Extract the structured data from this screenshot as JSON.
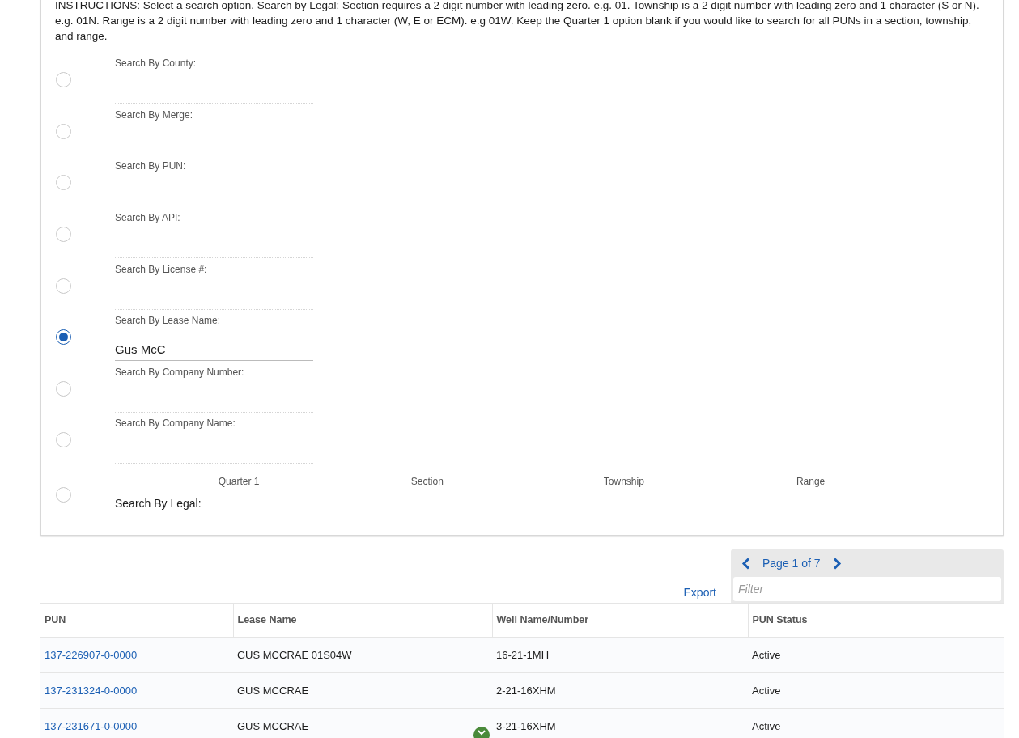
{
  "instructions": "INSTRUCTIONS: Select a search option. Search by Legal: Section requires a 2 digit number with leading zero. e.g. 01. Township is a 2 digit number with leading zero and 1 character (S or N). e.g. 01N. Range is a 2 digit number with leading zero and 1 character (W, E or ECM). e.g 01W. Keep the Quarter 1 option blank if you would like to search for all PUNs in a section, township, and range.",
  "search_options": [
    {
      "kind": "text",
      "label": "Search By County:",
      "selected": false
    },
    {
      "kind": "text",
      "label": "Search By Merge:",
      "selected": false
    },
    {
      "kind": "text",
      "label": "Search By PUN:",
      "selected": false
    },
    {
      "kind": "text",
      "label": "Search By API:",
      "selected": false
    },
    {
      "kind": "text",
      "label": "Search By License #:",
      "selected": false
    },
    {
      "kind": "text",
      "label": "Search By Lease Name:",
      "selected": true,
      "value": "Gus McC"
    },
    {
      "kind": "text",
      "label": "Search By Company Number:",
      "selected": false
    },
    {
      "kind": "text",
      "label": "Search By Company Name:",
      "selected": false
    },
    {
      "kind": "legal",
      "label": "Search By Legal:",
      "selected": false,
      "fields": [
        "Quarter 1",
        "Section",
        "Township",
        "Range"
      ]
    }
  ],
  "pager": {
    "label": "Page 1 of 7"
  },
  "filter": {
    "placeholder": "Filter"
  },
  "export": "Export",
  "table": {
    "columns": [
      "PUN",
      "Lease Name",
      "Well Name/Number",
      "PUN Status"
    ],
    "rows": [
      [
        "137-226907-0-0000",
        "GUS MCCRAE 01S04W",
        "16-21-1MH",
        "Active"
      ],
      [
        "137-231324-0-0000",
        "GUS MCCRAE",
        "2-21-16XHM",
        "Active"
      ],
      [
        "137-231671-0-0000",
        "GUS MCCRAE",
        "3-21-16XHM",
        "Active"
      ]
    ]
  }
}
